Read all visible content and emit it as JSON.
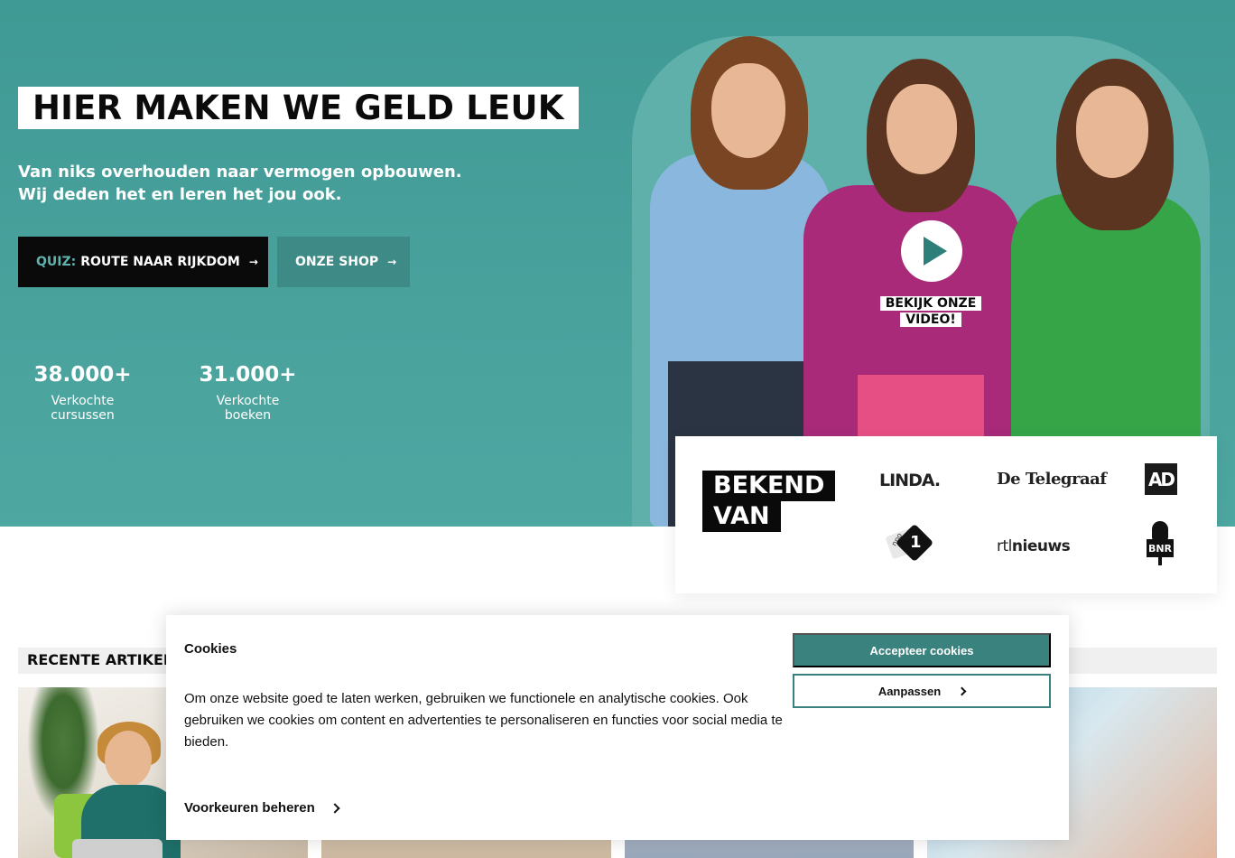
{
  "hero": {
    "headline": "HIER MAKEN WE GELD LEUK",
    "subtitle_line1": "Van niks overhouden naar vermogen opbouwen.",
    "subtitle_line2": "Wij deden het en leren het jou ook.",
    "quiz_prefix": "QUIZ:",
    "quiz_label": "ROUTE NAAR RIJKDOM",
    "shop_label": "ONZE SHOP",
    "arrow": "→",
    "stats": [
      {
        "value": "38.000+",
        "label": "Verkochte cursussen"
      },
      {
        "value": "31.000+",
        "label": "Verkochte boeken"
      }
    ],
    "video_label_line1": "BEKIJK ONZE",
    "video_label_line2": "VIDEO!"
  },
  "press": {
    "title_line1": "BEKEND",
    "title_line2": "VAN",
    "logos": {
      "linda": "LINDA.",
      "telegraaf": "De Telegraaf",
      "ad": "AD",
      "npo_small": "npo",
      "npo_number": "1",
      "rtl_prefix": "rtl",
      "rtl_suffix": "nieuws",
      "bnr": "BNR"
    }
  },
  "recent": {
    "title": "RECENTE ARTIKELEN"
  },
  "cookie": {
    "title": "Cookies",
    "text": "Om onze website goed te laten werken, gebruiken we functionele en analytische cookies. Ook gebruiken we cookies om content en advertenties te personaliseren en functies voor social media te bieden.",
    "preferences": "Voorkeuren beheren",
    "accept": "Accepteer cookies",
    "adjust": "Aanpassen"
  },
  "colors": {
    "hero_bg": "#4aa29d",
    "accent": "#3a827e",
    "dark": "#0a0a0a"
  },
  "icons": [
    "arrow-right-icon",
    "play-icon",
    "chevron-right-icon"
  ]
}
